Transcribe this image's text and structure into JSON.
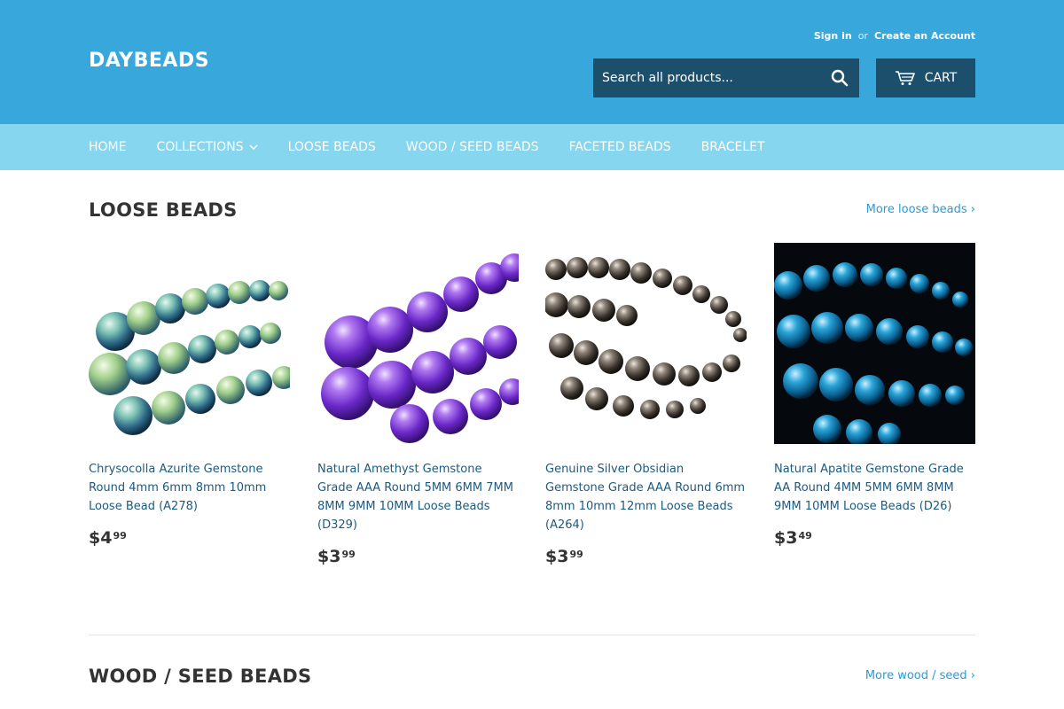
{
  "header": {
    "logo": "DAYBEADS",
    "sign_in": "Sign in",
    "or": "or",
    "create_account": "Create an Account",
    "search_placeholder": "Search all products...",
    "cart_label": "CART"
  },
  "nav": {
    "items": [
      "HOME",
      "COLLECTIONS",
      "LOOSE BEADS",
      "WOOD / SEED BEADS",
      "FACETED BEADS",
      "BRACELET"
    ]
  },
  "sections": [
    {
      "title": "LOOSE BEADS",
      "more_link": "More loose beads ›",
      "products": [
        {
          "title": "Chrysocolla Azurite Gemstone Round 4mm 6mm 8mm 10mm Loose Bead (A278)",
          "price_main": "$4",
          "price_cents": "99"
        },
        {
          "title": "Natural Amethyst Gemstone Grade AAA Round 5MM 6MM 7MM 8MM 9MM 10MM Loose Beads (D329)",
          "price_main": "$3",
          "price_cents": "99"
        },
        {
          "title": "Genuine Silver Obsidian Gemstone Grade AAA Round 6mm 8mm 10mm 12mm Loose Beads (A264)",
          "price_main": "$3",
          "price_cents": "99"
        },
        {
          "title": "Natural Apatite Gemstone Grade AA Round 4MM 5MM 6MM 8MM 9MM 10MM Loose Beads (D26)",
          "price_main": "$3",
          "price_cents": "49"
        }
      ]
    },
    {
      "title": "WOOD / SEED BEADS",
      "more_link": "More wood / seed ›"
    }
  ],
  "colors": {
    "header_bg": "#38a8dc",
    "nav_bg": "#86d6f0",
    "button_bg": "#1c4f6b",
    "link": "#2a9bd6",
    "product_title": "#1c5a80"
  }
}
